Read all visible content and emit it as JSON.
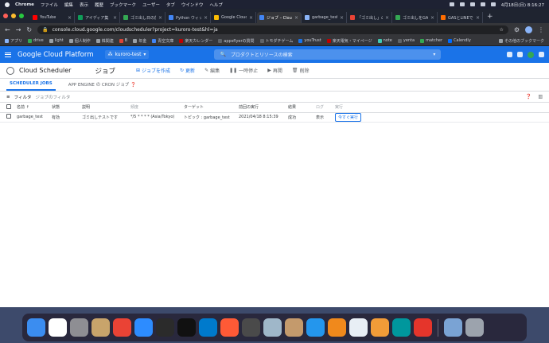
{
  "menubar": {
    "app": "Chrome",
    "items": [
      "ファイル",
      "編集",
      "表示",
      "履歴",
      "ブックマーク",
      "ユーザー",
      "タブ",
      "ウインドウ",
      "ヘルプ"
    ],
    "datetime": "4月18日(日) 8:16:27"
  },
  "tabs": [
    {
      "label": "YouTube",
      "color": "#ff0000"
    },
    {
      "label": "アイディア集",
      "color": "#0f9d58"
    },
    {
      "label": "ゴミ出し日の前日",
      "color": "#34a853"
    },
    {
      "label": "Python ウィッシュ",
      "color": "#4285f4"
    },
    {
      "label": "Google Cloud",
      "color": "#fbbc04"
    },
    {
      "label": "ジョブ – Cloud",
      "color": "#4285f4",
      "active": true
    },
    {
      "label": "garbage_test",
      "color": "#8ab4f8"
    },
    {
      "label": "「ゴミ出し」の",
      "color": "#ea4335"
    },
    {
      "label": "ゴミ出しをGAS",
      "color": "#34a853"
    },
    {
      "label": "GASとLINEで",
      "color": "#ff6d00"
    }
  ],
  "toolbar": {
    "url": "console.cloud.google.com/cloudscheduler?project=kuroro-test&hl=ja"
  },
  "bookmarks": [
    {
      "label": "アプリ",
      "color": "#8ab4f8"
    },
    {
      "label": "drive",
      "color": "#34a853"
    },
    {
      "label": "light",
      "color": "#9aa0a6"
    },
    {
      "label": "個人制作",
      "color": "#9aa0a6"
    },
    {
      "label": "株関連",
      "color": "#9aa0a6"
    },
    {
      "label": "B",
      "color": "#db4437"
    },
    {
      "label": "年金",
      "color": "#9aa0a6"
    },
    {
      "label": "青空文庫",
      "color": "#4285f4"
    },
    {
      "label": "楽天カレンダー",
      "color": "#bf0000"
    },
    {
      "label": "appsflyerの質問",
      "color": "#5f6368"
    },
    {
      "label": "トモダチゲーム",
      "color": "#5f6368"
    },
    {
      "label": "youTrust",
      "color": "#1a73e8"
    },
    {
      "label": "楽天電気・マイページ",
      "color": "#bf0000"
    },
    {
      "label": "note",
      "color": "#41c9b4"
    },
    {
      "label": "yenta",
      "color": "#5f6368"
    },
    {
      "label": "matcher",
      "color": "#34a853"
    },
    {
      "label": "Calendly",
      "color": "#006bff"
    }
  ],
  "bookmarks_other": "その他のブックマーク",
  "gcp": {
    "platform": "Google Cloud Platform",
    "project": "kuroro-test",
    "search_placeholder": "プロダクトとリソースの検索"
  },
  "service": {
    "name": "Cloud Scheduler",
    "page_title": "ジョブ",
    "actions": {
      "create": "ジョブを作成",
      "refresh": "更新",
      "edit": "編集",
      "pause": "一時停止",
      "resume": "再開",
      "delete": "削除"
    }
  },
  "subtabs": {
    "scheduler": "SCHEDULER JOBS",
    "appengine": "APP ENGINE の CRON ジョブ"
  },
  "filter": {
    "label": "フィルタ",
    "placeholder": "ジョブのフィルタ"
  },
  "table": {
    "headers": {
      "name": "名前",
      "status": "状態",
      "description": "説明",
      "frequency": "頻度",
      "target": "ターゲット",
      "last_run": "前回の実行",
      "result": "結果",
      "log": "ログ",
      "run": "実行"
    },
    "rows": [
      {
        "name": "garbage_test",
        "status": "有効",
        "description": "ゴミ出しテストです",
        "frequency": "*/5 * * * * (Asia/Tokyo)",
        "target": "トピック : garbage_test",
        "last_run": "2021/04/18 8:15:39",
        "result": "成功",
        "log": "表示",
        "run": "今すぐ実行"
      }
    ]
  },
  "dock": [
    {
      "name": "finder-icon",
      "color": "#3b8df0"
    },
    {
      "name": "calendar-icon",
      "color": "#ffffff"
    },
    {
      "name": "system-preferences-icon",
      "color": "#8e8e93"
    },
    {
      "name": "contacts-icon",
      "color": "#c8a46b"
    },
    {
      "name": "chrome-icon",
      "color": "#ea4335"
    },
    {
      "name": "zoom-icon",
      "color": "#2d8cff"
    },
    {
      "name": "terminal-icon",
      "color": "#2b2b2b"
    },
    {
      "name": "terminal2-icon",
      "color": "#111111"
    },
    {
      "name": "vscode-icon",
      "color": "#007acc"
    },
    {
      "name": "safari-icon",
      "color": "#ff5a36"
    },
    {
      "name": "quicktime-icon",
      "color": "#4a4a4a"
    },
    {
      "name": "sequel-icon",
      "color": "#9fb7c9"
    },
    {
      "name": "script-editor-icon",
      "color": "#c49a6c"
    },
    {
      "name": "docker-icon",
      "color": "#2496ed"
    },
    {
      "name": "sourcetree-icon",
      "color": "#f0891c"
    },
    {
      "name": "mysql-workbench-icon",
      "color": "#e8eef5"
    },
    {
      "name": "photo-app-icon",
      "color": "#f29c38"
    },
    {
      "name": "arduino-icon",
      "color": "#00979d"
    },
    {
      "name": "clock-icon",
      "color": "#e5352b"
    },
    {
      "name": "preview-icon",
      "color": "#7aa3d4"
    },
    {
      "name": "trash-icon",
      "color": "#9ca3ad"
    }
  ]
}
